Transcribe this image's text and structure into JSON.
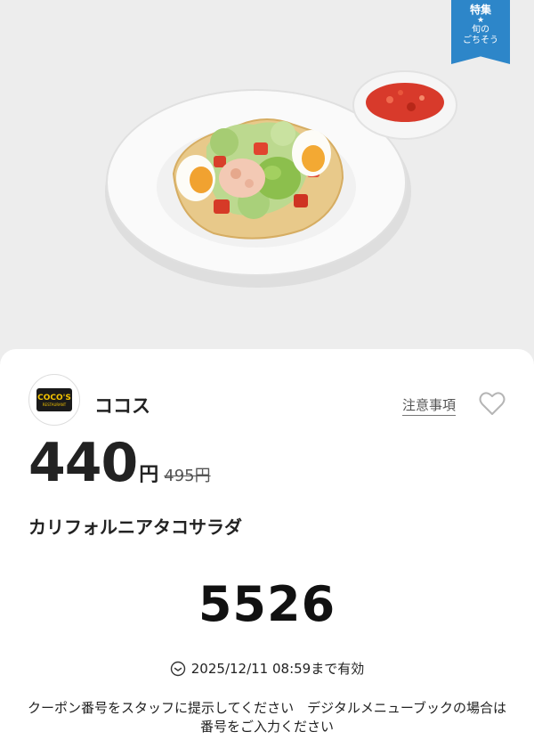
{
  "banner": {
    "tag_top": "特集",
    "tag_star": "★",
    "tag_line1": "旬の",
    "tag_line2": "ごちそう"
  },
  "store": {
    "logo_text": "COCO'S",
    "logo_sub": "RESTAURANT",
    "name": "ココス",
    "notes_label": "注意事項"
  },
  "offer": {
    "price": "440",
    "currency": "円",
    "original_price": "495円",
    "item_name": "カリフォルニアタコサラダ"
  },
  "coupon": {
    "code": "5526",
    "expiry": "2025/12/11 08:59まで有効",
    "instructions": "クーポン番号をスタッフに提示してください　デジタルメニューブックの場合は番号をご入力ください"
  },
  "colors": {
    "ribbon": "#2d86c9",
    "logo_bg": "#1a1a1a",
    "logo_text": "#f4c400"
  }
}
